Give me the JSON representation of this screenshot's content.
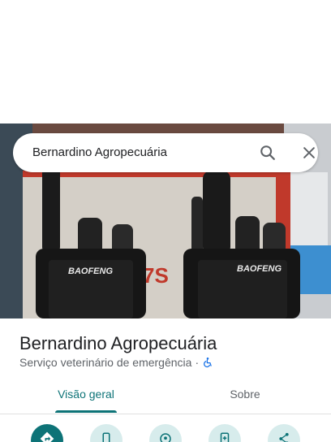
{
  "search": {
    "query": "Bernardino Agropecuária",
    "search_icon": "search-icon",
    "close_icon": "close-icon"
  },
  "place": {
    "name": "Bernardino Agropecuária",
    "category": "Serviço veterinário de emergência",
    "separator": "·",
    "accessibility_icon": "wheelchair-icon"
  },
  "photo": {
    "brand_label_left": "BAOFENG",
    "brand_label_right": "BAOFENG",
    "box_text": "7S"
  },
  "tabs": [
    {
      "label": "Visão geral",
      "selected": true
    },
    {
      "label": "Sobre",
      "selected": false
    }
  ],
  "actions": [
    {
      "icon": "directions-icon"
    },
    {
      "icon": "phone-icon"
    },
    {
      "icon": "location-icon"
    },
    {
      "icon": "save-icon"
    },
    {
      "icon": "share-icon"
    }
  ],
  "colors": {
    "accent": "#0d7377",
    "action_bg": "#d7ecec",
    "text_primary": "#202124",
    "text_secondary": "#5f6368"
  }
}
